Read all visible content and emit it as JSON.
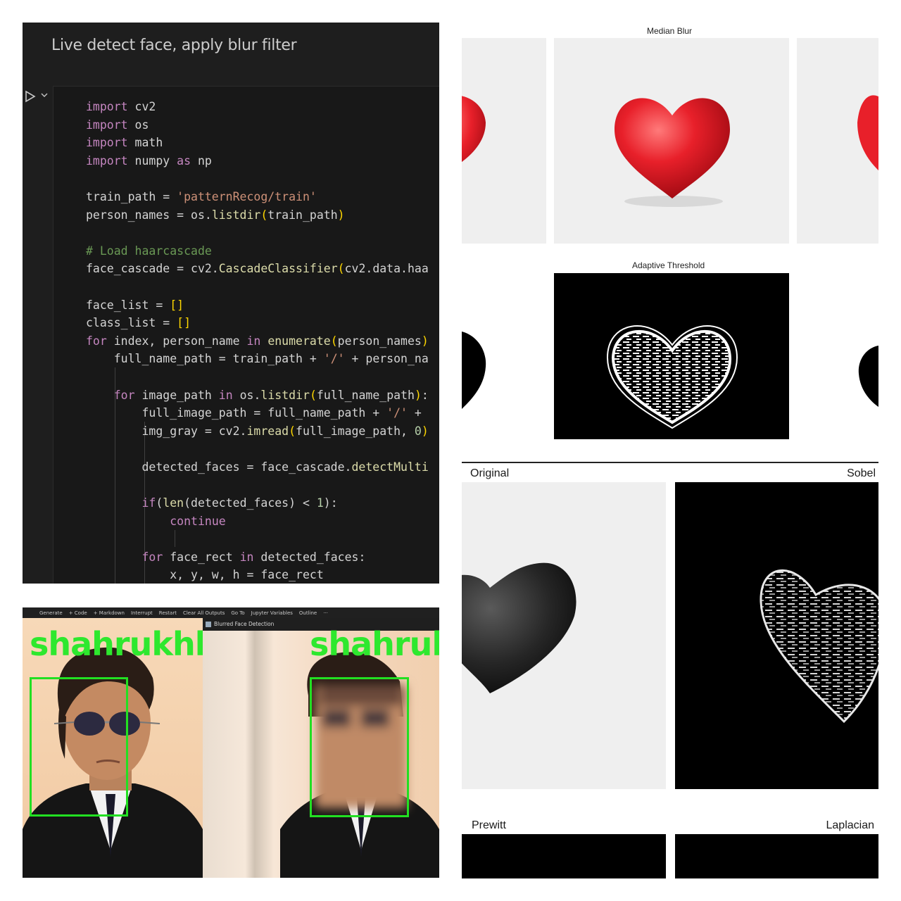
{
  "notebook": {
    "cell_title": "Live detect face, apply blur filter",
    "run_icon": "play-icon",
    "collapse_icon": "chevron-down-icon",
    "code_lines": [
      [
        {
          "t": "import",
          "c": "kw"
        },
        {
          "t": " cv2"
        }
      ],
      [
        {
          "t": "import",
          "c": "kw"
        },
        {
          "t": " os"
        }
      ],
      [
        {
          "t": "import",
          "c": "kw"
        },
        {
          "t": " math"
        }
      ],
      [
        {
          "t": "import",
          "c": "kw"
        },
        {
          "t": " numpy "
        },
        {
          "t": "as",
          "c": "kw"
        },
        {
          "t": " np"
        }
      ],
      [],
      [
        {
          "t": "train_path = "
        },
        {
          "t": "'patternRecog/train'",
          "c": "str"
        }
      ],
      [
        {
          "t": "person_names = os."
        },
        {
          "t": "listdir",
          "c": "fn"
        },
        {
          "t": "(",
          "c": "br"
        },
        {
          "t": "train_path"
        },
        {
          "t": ")",
          "c": "br"
        }
      ],
      [],
      [
        {
          "t": "# Load haarcascade",
          "c": "cm"
        }
      ],
      [
        {
          "t": "face_cascade = cv2."
        },
        {
          "t": "CascadeClassifier",
          "c": "fn"
        },
        {
          "t": "(",
          "c": "br"
        },
        {
          "t": "cv2.data.haa"
        }
      ],
      [],
      [
        {
          "t": "face_list = "
        },
        {
          "t": "[]",
          "c": "br"
        }
      ],
      [
        {
          "t": "class_list = "
        },
        {
          "t": "[]",
          "c": "br"
        }
      ],
      [
        {
          "t": "for",
          "c": "kw"
        },
        {
          "t": " index, person_name "
        },
        {
          "t": "in",
          "c": "kw"
        },
        {
          "t": " "
        },
        {
          "t": "enumerate",
          "c": "fn"
        },
        {
          "t": "(",
          "c": "br"
        },
        {
          "t": "person_names"
        },
        {
          "t": ")",
          "c": "br"
        }
      ],
      [
        {
          "t": "    full_name_path = train_path + "
        },
        {
          "t": "'/'",
          "c": "str"
        },
        {
          "t": " + person_na"
        }
      ],
      [],
      [
        {
          "t": "    "
        },
        {
          "t": "for",
          "c": "kw"
        },
        {
          "t": " image_path "
        },
        {
          "t": "in",
          "c": "kw"
        },
        {
          "t": " os."
        },
        {
          "t": "listdir",
          "c": "fn"
        },
        {
          "t": "(",
          "c": "br"
        },
        {
          "t": "full_name_path"
        },
        {
          "t": ")",
          "c": "br"
        },
        {
          "t": ":"
        }
      ],
      [
        {
          "t": "        full_image_path = full_name_path + "
        },
        {
          "t": "'/'",
          "c": "str"
        },
        {
          "t": " +"
        }
      ],
      [
        {
          "t": "        img_gray = cv2."
        },
        {
          "t": "imread",
          "c": "fn"
        },
        {
          "t": "(",
          "c": "br"
        },
        {
          "t": "full_image_path, "
        },
        {
          "t": "0",
          "c": "num"
        },
        {
          "t": ")",
          "c": "br"
        }
      ],
      [],
      [
        {
          "t": "        detected_faces = face_cascade."
        },
        {
          "t": "detectMulti",
          "c": "fn"
        }
      ],
      [],
      [
        {
          "t": "        "
        },
        {
          "t": "if",
          "c": "kw"
        },
        {
          "t": "("
        },
        {
          "t": "len",
          "c": "fn"
        },
        {
          "t": "(detected_faces) < "
        },
        {
          "t": "1",
          "c": "num"
        },
        {
          "t": "):"
        }
      ],
      [
        {
          "t": "            "
        },
        {
          "t": "continue",
          "c": "kw"
        }
      ],
      [],
      [
        {
          "t": "        "
        },
        {
          "t": "for",
          "c": "kw"
        },
        {
          "t": " face_rect "
        },
        {
          "t": "in",
          "c": "kw"
        },
        {
          "t": " detected_faces:"
        }
      ],
      [
        {
          "t": "            x, y, w, h = face_rect"
        }
      ]
    ]
  },
  "toolbar": {
    "items": [
      "Generate",
      "+ Code",
      "+ Markdown",
      "Interrupt",
      "Restart",
      "Clear All Outputs",
      "Go To",
      "Jupyter Variables",
      "Outline",
      "···"
    ]
  },
  "detection": {
    "label": "shahrukhkh",
    "window_title": "Blurred Face Detection"
  },
  "filters": {
    "median_title": "Median Blur",
    "adaptive_title": "Adaptive Threshold",
    "original_title": "Original",
    "sobel_title": "Sobel",
    "prewitt_title": "Prewitt",
    "laplacian_title": "Laplacian"
  },
  "colors": {
    "heart_red": "#e8202a",
    "box_green": "#22e022",
    "editor_bg": "#1e1e1e"
  }
}
